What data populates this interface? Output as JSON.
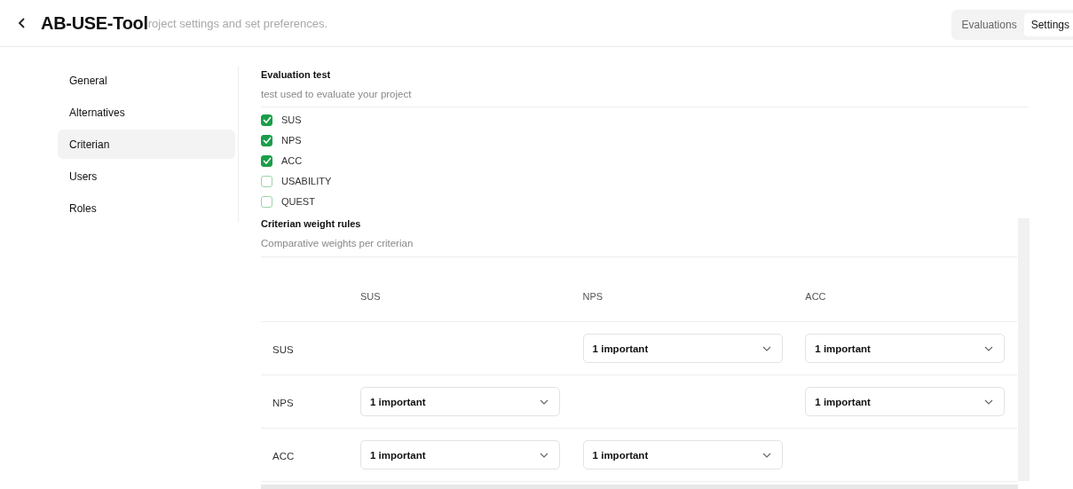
{
  "header": {
    "title": "AB-USE-Tool",
    "subtitle": "roject settings and set preferences."
  },
  "view_tabs": [
    {
      "label": "Evaluations",
      "selected": false
    },
    {
      "label": "Settings",
      "selected": true
    }
  ],
  "sidebar": {
    "items": [
      {
        "label": "General",
        "selected": false
      },
      {
        "label": "Alternatives",
        "selected": false
      },
      {
        "label": "Criterian",
        "selected": true
      },
      {
        "label": "Users",
        "selected": false
      },
      {
        "label": "Roles",
        "selected": false
      }
    ]
  },
  "evaluation_test": {
    "title": "Evaluation test",
    "description": "test used to evaluate your project",
    "options": [
      {
        "label": "SUS",
        "checked": true
      },
      {
        "label": "NPS",
        "checked": true
      },
      {
        "label": "ACC",
        "checked": true
      },
      {
        "label": "USABILITY",
        "checked": false
      },
      {
        "label": "QUEST",
        "checked": false
      }
    ]
  },
  "weight_rules": {
    "title": "Criterian weight rules",
    "description": "Comparative weights per criterian",
    "columns": [
      "SUS",
      "NPS",
      "ACC"
    ],
    "rows": [
      {
        "label": "SUS",
        "cells": [
          null,
          "1 important",
          "1 important"
        ]
      },
      {
        "label": "NPS",
        "cells": [
          "1 important",
          null,
          "1 important"
        ]
      },
      {
        "label": "ACC",
        "cells": [
          "1 important",
          "1 important",
          null
        ]
      }
    ]
  }
}
